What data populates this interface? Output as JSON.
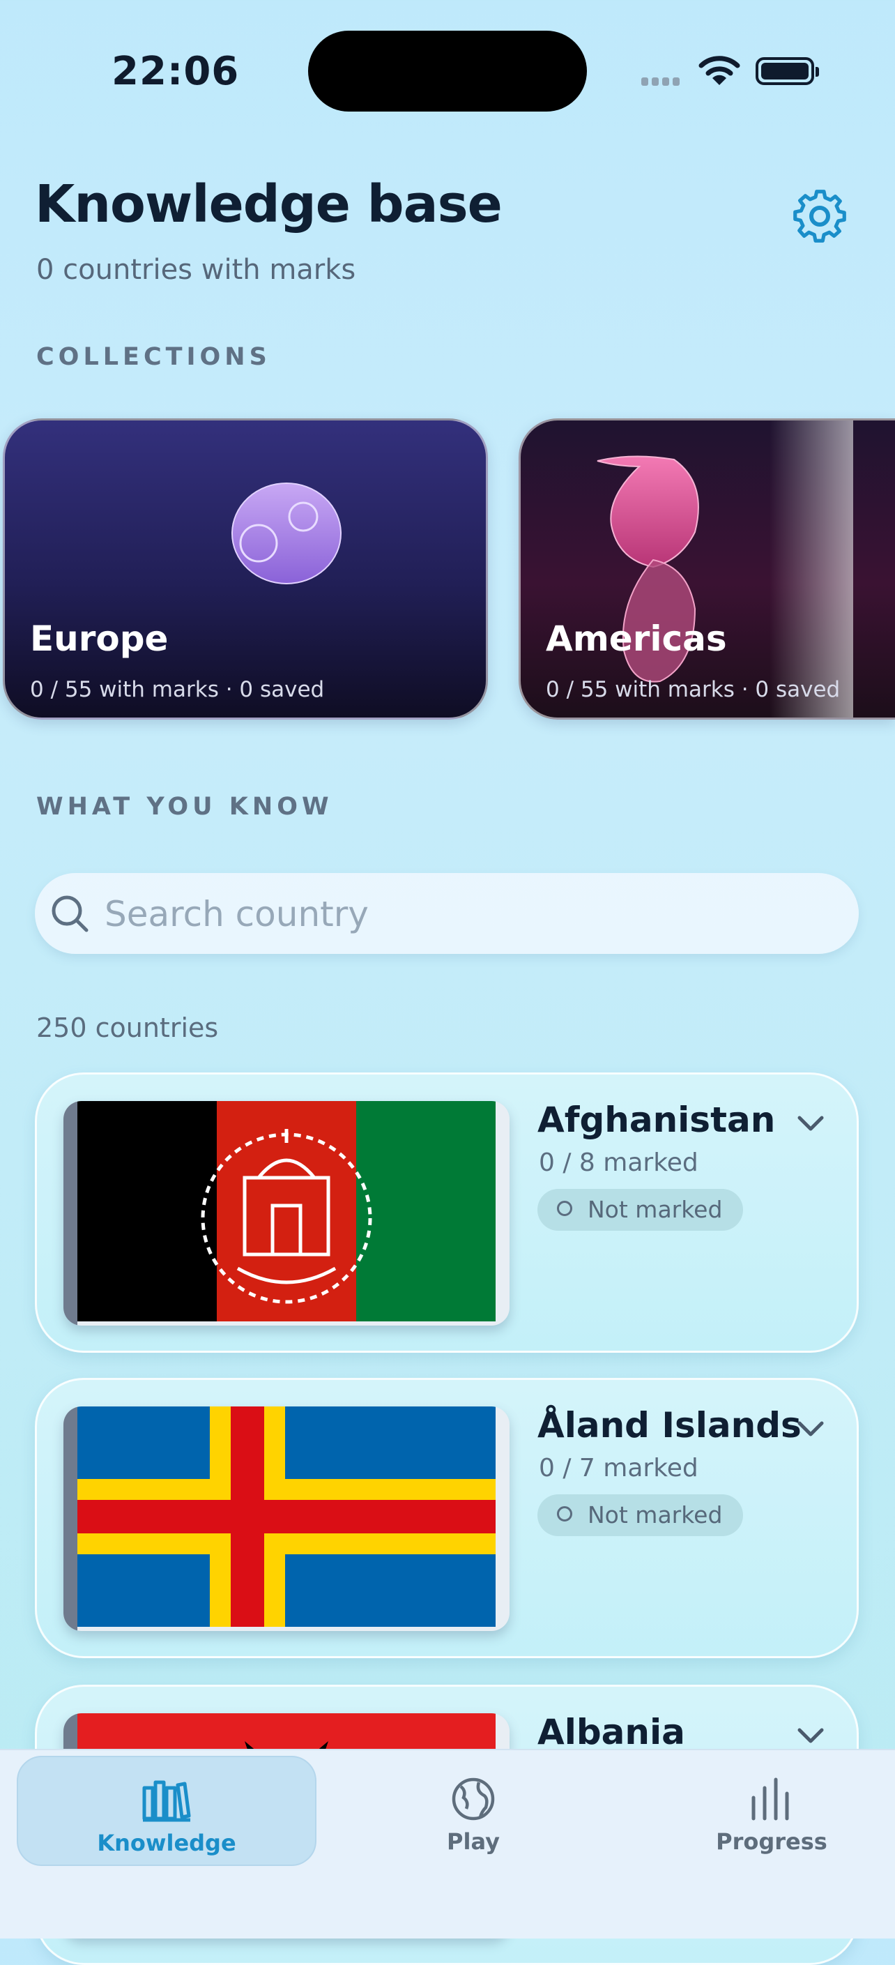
{
  "status_bar": {
    "time": "22:06"
  },
  "header": {
    "title": "Knowledge base",
    "subtitle": "0 countries with marks"
  },
  "collections": {
    "label": "COLLECTIONS",
    "items": [
      {
        "title": "Europe",
        "stats": "0 / 55 with marks · 0 saved"
      },
      {
        "title": "Americas",
        "stats": "0 / 55 with marks · 0 saved"
      }
    ]
  },
  "know": {
    "label": "WHAT YOU KNOW"
  },
  "search": {
    "placeholder": "Search country",
    "value": ""
  },
  "list": {
    "count": "250 countries",
    "countries": [
      {
        "name": "Afghanistan",
        "marked": "0 / 8 marked",
        "status": "Not marked"
      },
      {
        "name": "Åland Islands",
        "marked": "0 / 7 marked",
        "status": "Not marked"
      },
      {
        "name": "Albania"
      }
    ]
  },
  "tabs": [
    {
      "label": "Knowledge",
      "active": true
    },
    {
      "label": "Play"
    },
    {
      "label": "Progress"
    }
  ],
  "colors": {
    "accent": "#1a8ec9",
    "europe_card": "#2a2766",
    "americas_card": "#3a1232"
  }
}
